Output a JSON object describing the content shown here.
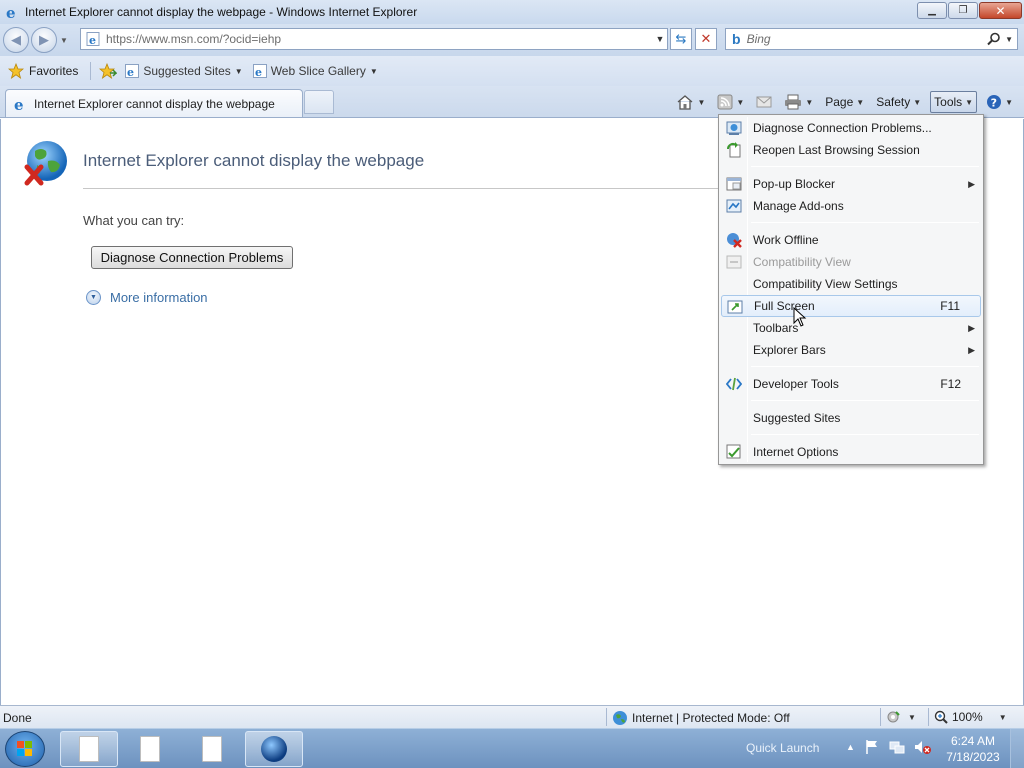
{
  "window": {
    "title": "Internet Explorer cannot display the webpage - Windows Internet Explorer"
  },
  "address": {
    "url": "https://www.msn.com/?ocid=iehp",
    "search_placeholder": "Bing"
  },
  "favorites_bar": {
    "favorites_label": "Favorites",
    "items": [
      {
        "label": "Suggested Sites"
      },
      {
        "label": "Web Slice Gallery"
      }
    ]
  },
  "tab": {
    "title": "Internet Explorer cannot display the webpage"
  },
  "command_bar": {
    "page": "Page",
    "safety": "Safety",
    "tools": "Tools"
  },
  "error_page": {
    "title": "Internet Explorer cannot display the webpage",
    "what_to_try": "What you can try:",
    "diagnose_button": "Diagnose Connection Problems",
    "more_information": "More information"
  },
  "tools_menu": {
    "items": [
      {
        "label": "Diagnose Connection Problems...",
        "icon": "diagnose-icon"
      },
      {
        "label": "Reopen Last Browsing Session",
        "icon": "reopen-icon"
      },
      {
        "label": "Pop-up Blocker",
        "submenu": true,
        "icon": "popup-blocker-icon"
      },
      {
        "label": "Manage Add-ons",
        "icon": "addons-icon"
      },
      {
        "label": "Work Offline",
        "icon": "work-offline-icon"
      },
      {
        "label": "Compatibility View",
        "disabled": true,
        "icon": "compat-view-icon"
      },
      {
        "label": "Compatibility View Settings"
      },
      {
        "label": "Full Screen",
        "shortcut": "F11",
        "icon": "fullscreen-icon",
        "highlighted": true
      },
      {
        "label": "Toolbars",
        "submenu": true
      },
      {
        "label": "Explorer Bars",
        "submenu": true
      },
      {
        "label": "Developer Tools",
        "shortcut": "F12",
        "icon": "developer-tools-icon"
      },
      {
        "label": "Suggested Sites"
      },
      {
        "label": "Internet Options",
        "icon": "internet-options-icon"
      }
    ]
  },
  "status_bar": {
    "status": "Done",
    "zone": "Internet | Protected Mode: Off",
    "zoom": "100%"
  },
  "taskbar": {
    "quick_launch": "Quick Launch",
    "time": "6:24 AM",
    "date": "7/18/2023"
  }
}
